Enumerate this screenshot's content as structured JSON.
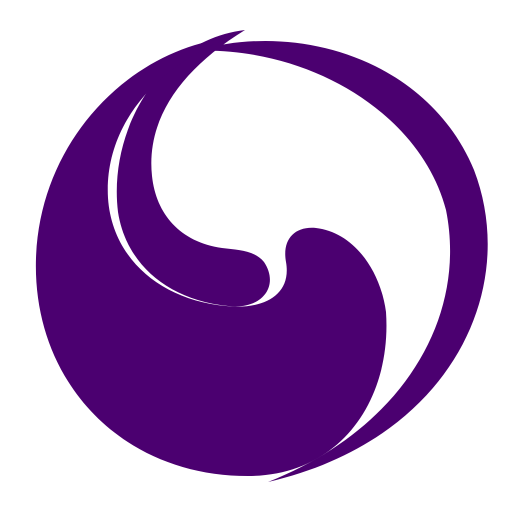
{
  "logo": {
    "icon": "swirl-logo-icon",
    "colors": {
      "primary": "#4B0070",
      "background": "#FFFFFF"
    }
  }
}
